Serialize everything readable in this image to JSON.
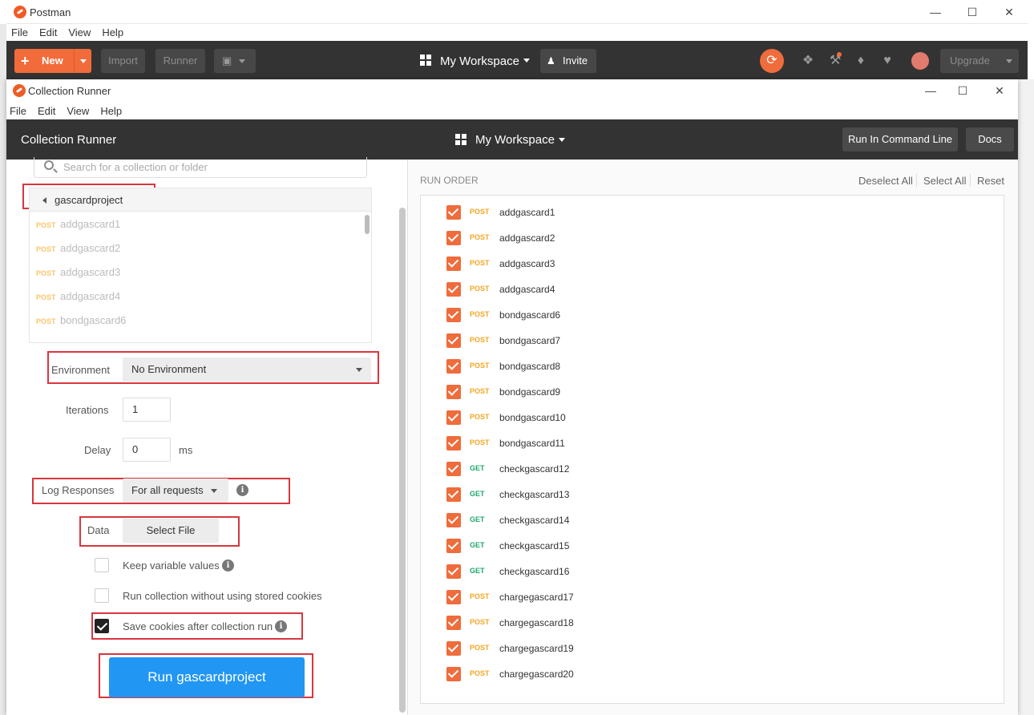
{
  "background_app": {
    "title": "Postman",
    "menu": [
      "File",
      "Edit",
      "View",
      "Help"
    ],
    "toolbar": {
      "new_label": "New",
      "import_label": "Import",
      "runner_label": "Runner",
      "workspace_label": "My Workspace",
      "invite_label": "Invite",
      "upgrade_label": "Upgrade"
    }
  },
  "runner": {
    "title": "Collection Runner",
    "menu": [
      "File",
      "Edit",
      "View",
      "Help"
    ],
    "header": {
      "title": "Collection Runner",
      "workspace_label": "My Workspace",
      "command_line_label": "Run In Command Line",
      "docs_label": "Docs"
    },
    "search": {
      "placeholder": "Search for a collection or folder"
    },
    "collection": {
      "name": "gascardproject",
      "requests": [
        {
          "method": "POST",
          "name": "addgascard1"
        },
        {
          "method": "POST",
          "name": "addgascard2"
        },
        {
          "method": "POST",
          "name": "addgascard3"
        },
        {
          "method": "POST",
          "name": "addgascard4"
        },
        {
          "method": "POST",
          "name": "bondgascard6"
        }
      ]
    },
    "settings": {
      "environment_label": "Environment",
      "environment_value": "No Environment",
      "iterations_label": "Iterations",
      "iterations_value": "1",
      "delay_label": "Delay",
      "delay_value": "0",
      "delay_unit": "ms",
      "log_label": "Log Responses",
      "log_value": "For all requests",
      "data_label": "Data",
      "data_button": "Select File",
      "keep_vars_label": "Keep variable values",
      "keep_vars_checked": false,
      "no_cookies_label": "Run collection without using stored cookies",
      "no_cookies_checked": false,
      "save_cookies_label": "Save cookies after collection run",
      "save_cookies_checked": true
    },
    "run_button_label": "Run gascardproject",
    "run_order": {
      "title": "RUN ORDER",
      "deselect_all": "Deselect All",
      "select_all": "Select All",
      "reset": "Reset",
      "items": [
        {
          "method": "POST",
          "name": "addgascard1"
        },
        {
          "method": "POST",
          "name": "addgascard2"
        },
        {
          "method": "POST",
          "name": "addgascard3"
        },
        {
          "method": "POST",
          "name": "addgascard4"
        },
        {
          "method": "POST",
          "name": "bondgascard6"
        },
        {
          "method": "POST",
          "name": "bondgascard7"
        },
        {
          "method": "POST",
          "name": "bondgascard8"
        },
        {
          "method": "POST",
          "name": "bondgascard9"
        },
        {
          "method": "POST",
          "name": "bondgascard10"
        },
        {
          "method": "POST",
          "name": "bondgascard11"
        },
        {
          "method": "GET",
          "name": "checkgascard12"
        },
        {
          "method": "GET",
          "name": "checkgascard13"
        },
        {
          "method": "GET",
          "name": "checkgascard14"
        },
        {
          "method": "GET",
          "name": "checkgascard15"
        },
        {
          "method": "GET",
          "name": "checkgascard16"
        },
        {
          "method": "POST",
          "name": "chargegascard17"
        },
        {
          "method": "POST",
          "name": "chargegascard18"
        },
        {
          "method": "POST",
          "name": "chargegascard19"
        },
        {
          "method": "POST",
          "name": "chargegascard20"
        }
      ]
    }
  },
  "colors": {
    "accent_orange": "#ef6c3c",
    "run_blue": "#2196f3",
    "header_dark": "#333333",
    "highlight_red": "#d9363e"
  }
}
